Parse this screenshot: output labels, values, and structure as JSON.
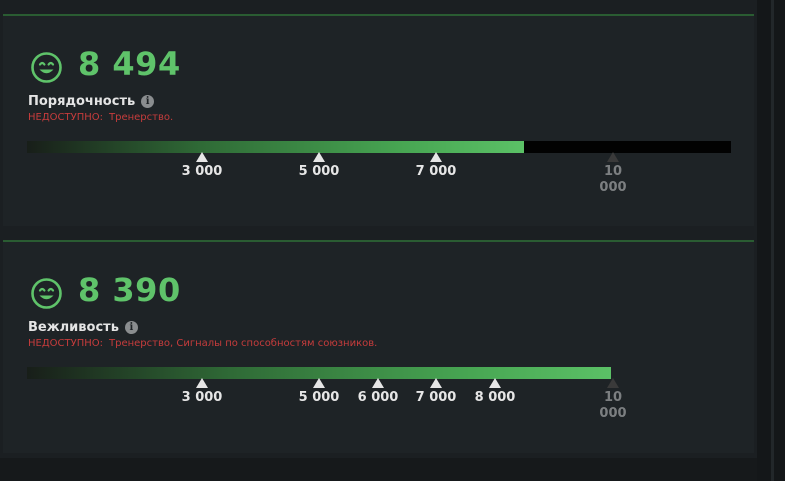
{
  "cards": [
    {
      "score": "8 494",
      "title": "Порядочность",
      "unavailable_label": "НЕДОСТУПНО:",
      "unavailable_text": "Тренерство.",
      "progress_fraction": 0.849,
      "markers": [
        {
          "label": "3 000",
          "state": "reached"
        },
        {
          "label": "5 000",
          "state": "reached"
        },
        {
          "label": "7 000",
          "state": "reached"
        },
        {
          "label": "10 000",
          "state": "locked"
        }
      ]
    },
    {
      "score": "8 390",
      "title": "Вежливость",
      "unavailable_label": "НЕДОСТУПНО:",
      "unavailable_text": "Тренерство, Сигналы по способностям союзников.",
      "progress_fraction": 0.839,
      "markers": [
        {
          "label": "3 000",
          "state": "reached"
        },
        {
          "label": "5 000",
          "state": "reached"
        },
        {
          "label": "6 000",
          "state": "reached"
        },
        {
          "label": "7 000",
          "state": "reached"
        },
        {
          "label": "8 000",
          "state": "reached"
        },
        {
          "label": "10 000",
          "state": "locked"
        }
      ]
    }
  ],
  "icons": {
    "face": "smiley-face-icon",
    "info": "info-icon",
    "reached_marker": "triangle-up-icon",
    "locked_marker": "triangle-up-dark-icon"
  },
  "colors": {
    "score": "#5fc36a",
    "unavailable": "#c63c3c",
    "bar_fill_end": "#5bc166",
    "panel_accent": "#2a5c32"
  }
}
